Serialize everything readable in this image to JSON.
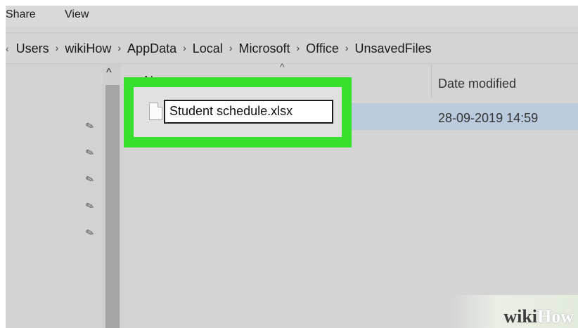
{
  "ribbon": {
    "share": "Share",
    "view": "View"
  },
  "address_bar": {
    "back_chevron": "‹",
    "segments": [
      "Users",
      "wikiHow",
      "AppData",
      "Local",
      "Microsoft",
      "Office",
      "UnsavedFiles"
    ],
    "separator": "›"
  },
  "nav": {
    "pin_icon": "✎",
    "scroll_up": "^"
  },
  "columns": {
    "name": "N",
    "date_modified": "Date modified",
    "sort_indicator": "^"
  },
  "files": [
    {
      "name": "Student schedule.xlsx",
      "date": "28-09-2019 14:59",
      "selected": true,
      "renaming": true
    }
  ],
  "watermark": {
    "part1": "wiki",
    "part2": "How"
  },
  "colors": {
    "highlight": "#37e02c",
    "selection": "#b9cbdc"
  }
}
